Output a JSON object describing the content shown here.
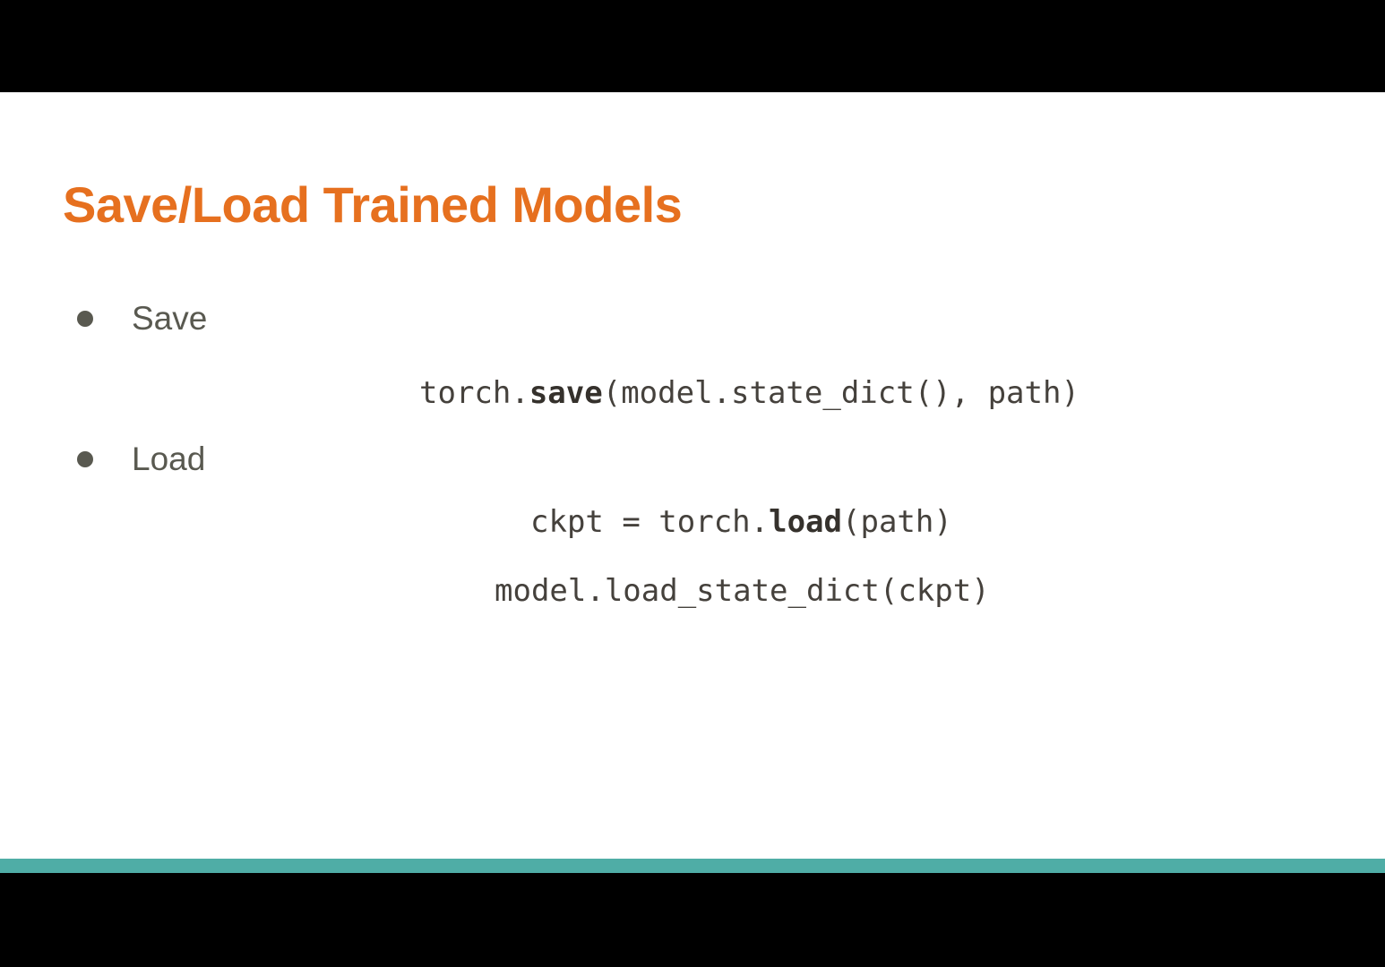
{
  "slide": {
    "title": "Save/Load Trained Models",
    "bullets": [
      {
        "label": "Save",
        "code": [
          {
            "prefix": "torch.",
            "keyword": "save",
            "suffix": "(model.state_dict(), path)"
          }
        ]
      },
      {
        "label": "Load",
        "code": [
          {
            "prefix": "ckpt = torch.",
            "keyword": "load",
            "suffix": "(path)"
          },
          {
            "prefix": "model.load_state_dict(ckpt)",
            "keyword": "",
            "suffix": ""
          }
        ]
      }
    ]
  },
  "colors": {
    "title": "#e6701f",
    "body_text": "#595950",
    "code_text": "#45413c",
    "accent_bar": "#4fada6",
    "slide_background": "#ffffff",
    "letterbox": "#000000"
  }
}
